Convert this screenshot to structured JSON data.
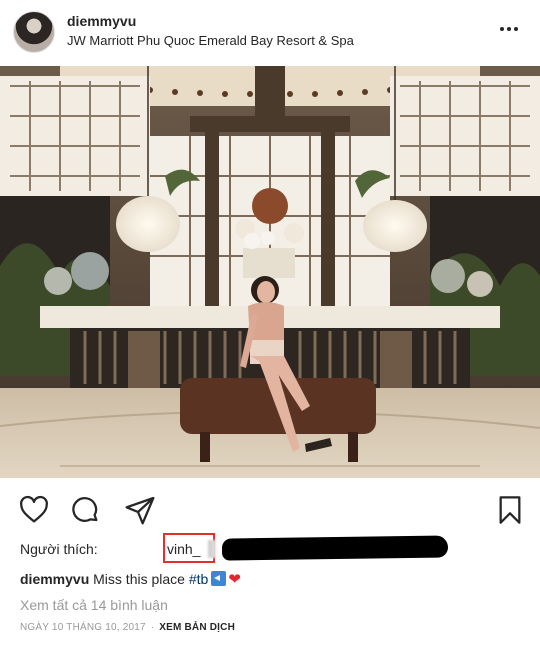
{
  "header": {
    "username": "diemmyvu",
    "location": "JW Marriott Phu Quoc Emerald Bay Resort & Spa"
  },
  "icons": [
    "heart-icon",
    "comment-icon",
    "share-icon",
    "bookmark-icon",
    "more-icon"
  ],
  "likes": {
    "label": "Người thích:",
    "first_liker": "vinh_"
  },
  "caption": {
    "username": "diemmyvu",
    "text": "Miss this place",
    "hashtag": "#tb"
  },
  "comments_link": "Xem tất cả 14 bình luận",
  "date": "NGÀY 10 THÁNG 10, 2017",
  "separator": "·",
  "translate_link": "XEM BẢN DỊCH",
  "colors": {
    "highlight_box": "#e0312f",
    "hashtag": "#003569",
    "muted_text": "#999999",
    "heart": "#e3262f"
  }
}
